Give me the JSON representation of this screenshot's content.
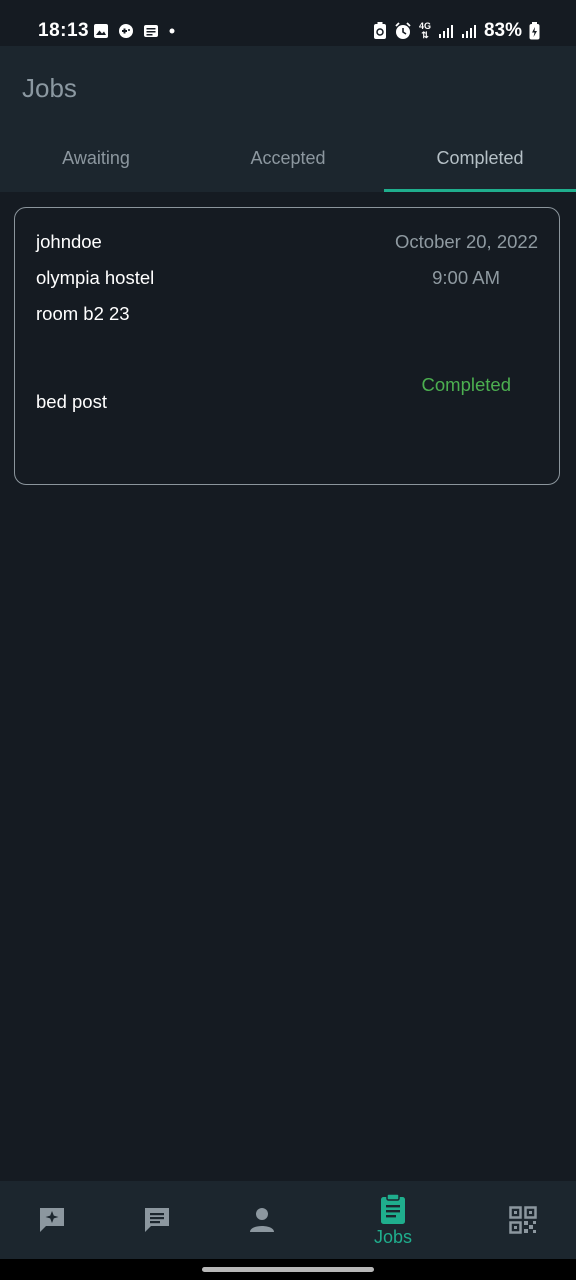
{
  "status_bar": {
    "time": "18:13",
    "network": "4G",
    "battery": "83%"
  },
  "app_bar": {
    "title": "Jobs",
    "tabs": [
      {
        "label": "Awaiting",
        "active": false
      },
      {
        "label": "Accepted",
        "active": false
      },
      {
        "label": "Completed",
        "active": true
      }
    ]
  },
  "jobs": [
    {
      "username": "johndoe",
      "location": "olympia hostel",
      "room": "room b2 23",
      "item": "bed post",
      "date": "October 20, 2022",
      "time": "9:00 AM",
      "status": "Completed"
    }
  ],
  "bottom_nav": {
    "items": [
      {
        "icon": "sparkle-chat-icon",
        "label": ""
      },
      {
        "icon": "message-icon",
        "label": ""
      },
      {
        "icon": "person-icon",
        "label": ""
      },
      {
        "icon": "clipboard-icon",
        "label": "Jobs",
        "active": true
      },
      {
        "icon": "qr-code-icon",
        "label": ""
      }
    ]
  },
  "colors": {
    "background": "#151b22",
    "surface": "#1c262e",
    "accent": "#1fae8d",
    "status_completed": "#4caf50"
  }
}
